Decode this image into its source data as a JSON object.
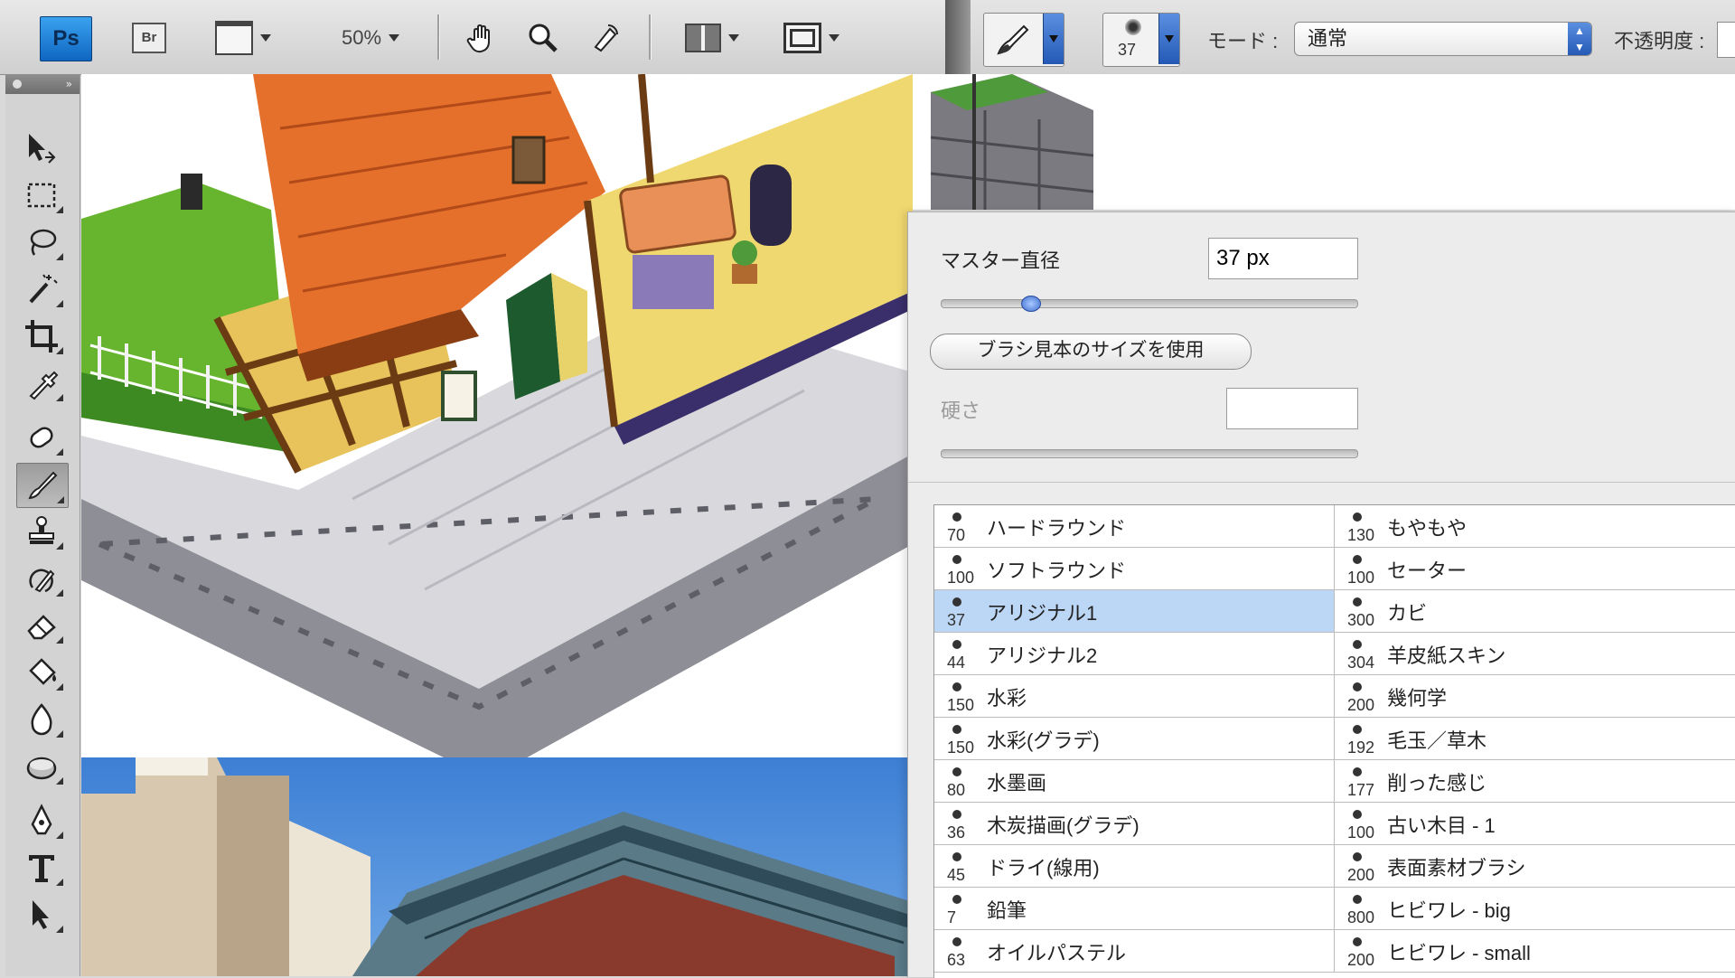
{
  "app": {
    "logo": "Ps",
    "bridge_label": "Br",
    "zoom": "50%"
  },
  "options_bar": {
    "brush_size": "37",
    "mode_label": "モード :",
    "mode_value": "通常",
    "opacity_label": "不透明度 :"
  },
  "brush_panel": {
    "master_diameter_label": "マスター直径",
    "master_diameter_value": "37 px",
    "master_diameter_fraction": 0.2,
    "use_sample_size_label": "ブラシ見本のサイズを使用",
    "hardness_label": "硬さ",
    "hardness_value": ""
  },
  "brushes": {
    "left": [
      {
        "size": "70",
        "name": "ハードラウンド"
      },
      {
        "size": "100",
        "name": "ソフトラウンド"
      },
      {
        "size": "37",
        "name": "アリジナル1",
        "selected": true
      },
      {
        "size": "44",
        "name": "アリジナル2"
      },
      {
        "size": "150",
        "name": "水彩"
      },
      {
        "size": "150",
        "name": "水彩(グラデ)"
      },
      {
        "size": "80",
        "name": "水墨画"
      },
      {
        "size": "36",
        "name": "木炭描画(グラデ)"
      },
      {
        "size": "45",
        "name": "ドライ(線用)"
      },
      {
        "size": "7",
        "name": "鉛筆"
      },
      {
        "size": "63",
        "name": "オイルパステル"
      }
    ],
    "right": [
      {
        "size": "130",
        "name": "もやもや"
      },
      {
        "size": "100",
        "name": "セーター"
      },
      {
        "size": "300",
        "name": "カビ"
      },
      {
        "size": "304",
        "name": "羊皮紙スキン"
      },
      {
        "size": "200",
        "name": "幾何学"
      },
      {
        "size": "192",
        "name": "毛玉／草木"
      },
      {
        "size": "177",
        "name": "削った感じ"
      },
      {
        "size": "100",
        "name": "古い木目 - 1"
      },
      {
        "size": "200",
        "name": "表面素材ブラシ"
      },
      {
        "size": "800",
        "name": "ヒビワレ - big"
      },
      {
        "size": "200",
        "name": "ヒビワレ - small"
      }
    ]
  },
  "colors": {
    "accent": "#2f6fd1",
    "selection": "#bcd6f5"
  }
}
